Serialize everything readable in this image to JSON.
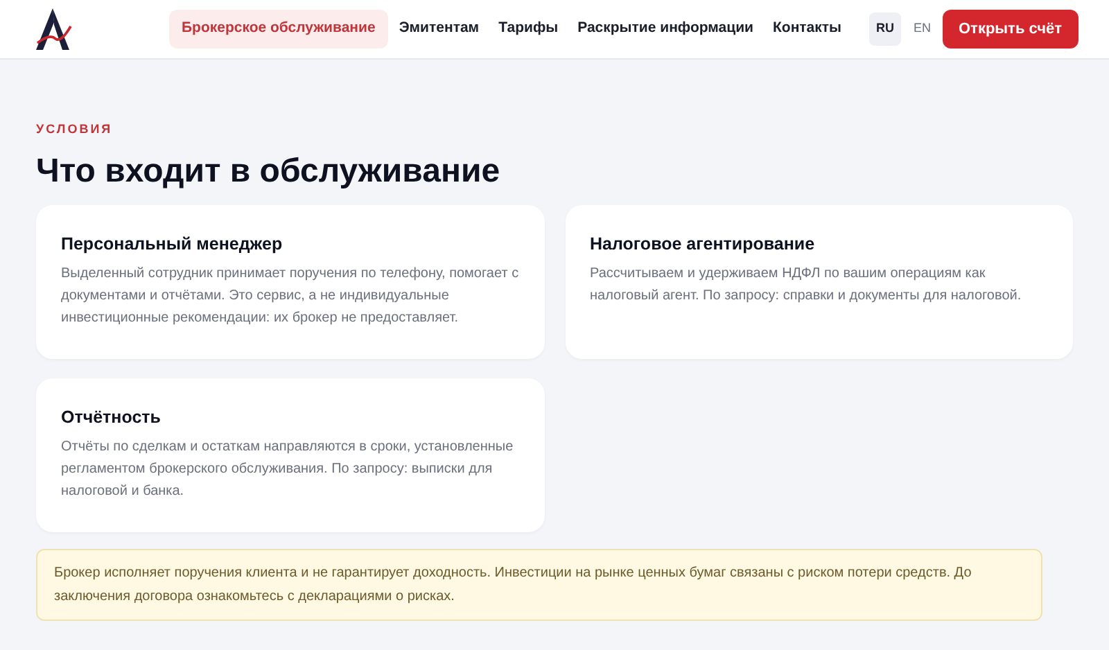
{
  "nav": {
    "items": [
      {
        "label": "Брокерское обслуживание",
        "selected": true
      },
      {
        "label": "Эмитентам",
        "selected": false
      },
      {
        "label": "Тарифы",
        "selected": false
      },
      {
        "label": "Раскрытие информации",
        "selected": false
      },
      {
        "label": "Контакты",
        "selected": false
      }
    ],
    "languages": [
      {
        "label": "RU",
        "selected": true
      },
      {
        "label": "EN",
        "selected": false
      }
    ],
    "cta": "Открыть счёт"
  },
  "section": {
    "eyebrow": "УСЛОВИЯ",
    "title": "Что входит в обслуживание",
    "cards": [
      {
        "title": "Персональный менеджер",
        "text": "Выделенный сотрудник принимает поручения по телефону, помогает с документами и отчётами. Это сервис, а не индивидуальные инвестиционные рекомендации: их брокер не предоставляет."
      },
      {
        "title": "Налоговое агентирование",
        "text": "Рассчитываем и удерживаем НДФЛ по вашим операциям как налоговый агент. По запросу: справки и документы для налоговой."
      },
      {
        "title": "Отчётность",
        "text": "Отчёты по сделкам и остаткам направляются в сроки, установленные регламентом брокерского обслуживания. По запросу: выписки для налоговой и банка."
      }
    ]
  },
  "notice": "Брокер исполняет поручения клиента и не гарантирует доходность. Инвестиции на рынке ценных бумаг связаны с риском потери средств. До заключения договора ознакомьтесь с декларациями о рисках."
}
